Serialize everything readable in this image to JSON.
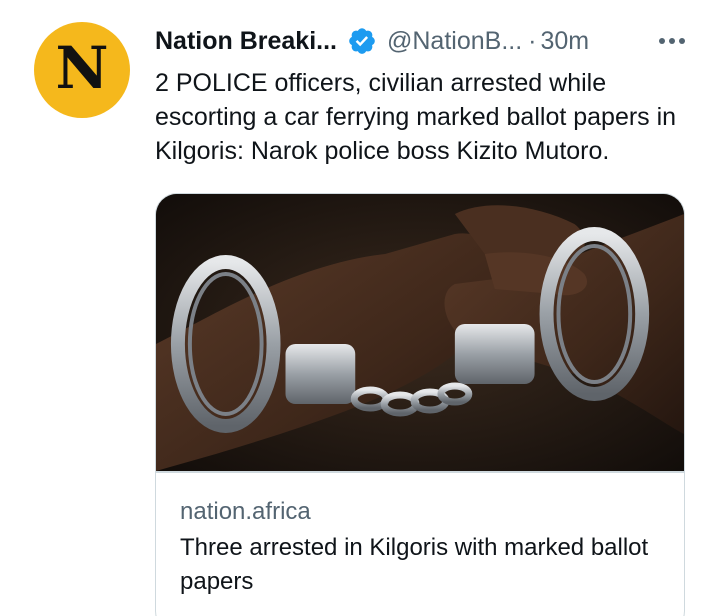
{
  "author": {
    "avatar_letter": "N",
    "display_name": "Nation Breaki...",
    "handle": "@NationB...",
    "separator": "·",
    "timestamp": "30m",
    "verified": true
  },
  "tweet": {
    "text": "2 POLICE officers, civilian arrested while escorting a car ferrying marked ballot papers in Kilgoris: Narok police boss Kizito Mutoro."
  },
  "card": {
    "domain": "nation.africa",
    "title": "Three arrested in Kilgoris with marked ballot papers",
    "image_subject": "handcuffed-hands"
  },
  "colors": {
    "avatar_bg": "#f5b81c",
    "verified_blue": "#1d9bf0",
    "secondary_text": "#536471",
    "primary_text": "#0f1419",
    "card_border": "#cfd9de"
  }
}
